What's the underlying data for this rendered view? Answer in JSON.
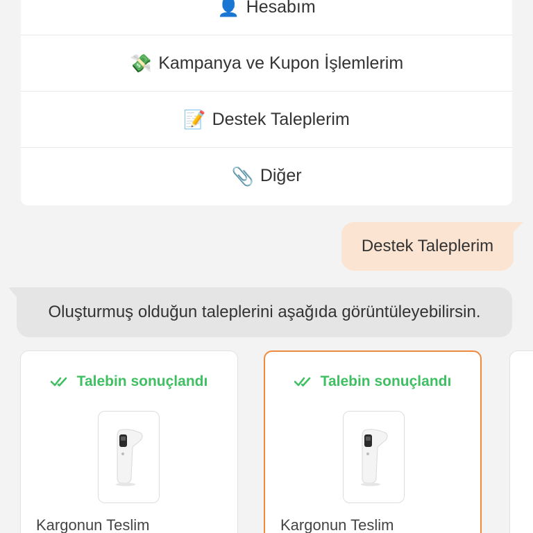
{
  "menu": {
    "items": [
      {
        "emoji": "👤",
        "label": "Hesabım"
      },
      {
        "emoji": "💸",
        "label": "Kampanya ve Kupon İşlemlerim"
      },
      {
        "emoji": "📝",
        "label": "Destek Taleplerim"
      },
      {
        "emoji": "📎",
        "label": "Diğer"
      }
    ]
  },
  "chat": {
    "user_message": "Destek Taleplerim",
    "bot_message": "Oluşturmuş olduğun taleplerini aşağıda görüntüleyebilirsin."
  },
  "tickets": [
    {
      "status": "Talebin sonuçlandı",
      "label": "Kargonun Teslim"
    },
    {
      "status": "Talebin sonuçlandı",
      "label": "Kargonun Teslim"
    }
  ],
  "colors": {
    "accent_orange": "#ef8a3c",
    "status_green": "#3fbf62",
    "user_bubble": "#fbe4d2",
    "bot_bubble": "#e5e5e5"
  },
  "icons": {
    "status_check": "double-check-icon",
    "product": "thermometer-product-image"
  }
}
